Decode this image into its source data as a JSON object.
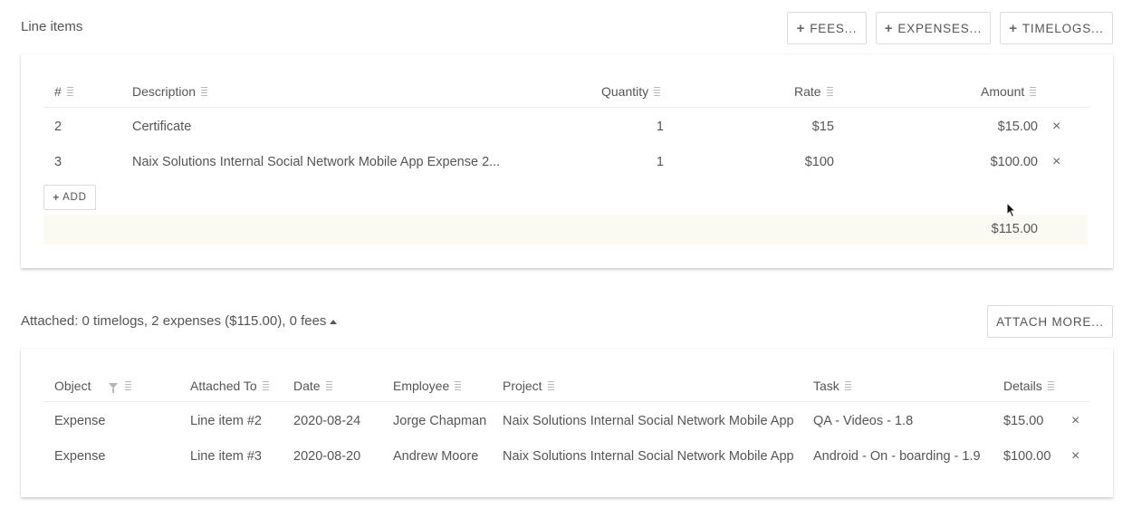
{
  "line_items": {
    "title": "Line items",
    "buttons": {
      "fees": "FEES...",
      "expenses": "EXPENSES...",
      "timelogs": "TIMELOGS..."
    },
    "columns": {
      "num": "#",
      "description": "Description",
      "quantity": "Quantity",
      "rate": "Rate",
      "amount": "Amount"
    },
    "rows": [
      {
        "num": "2",
        "description": "Certificate",
        "quantity": "1",
        "rate": "$15",
        "amount": "$15.00"
      },
      {
        "num": "3",
        "description": "Naix Solutions Internal Social Network Mobile App Expense 2...",
        "quantity": "1",
        "rate": "$100",
        "amount": "$100.00"
      }
    ],
    "add_label": "ADD",
    "total": "$115.00"
  },
  "attached": {
    "summary": "Attached: 0 timelogs, 2 expenses ($115.00), 0 fees",
    "attach_more": "ATTACH MORE...",
    "columns": {
      "object": "Object",
      "attached_to": "Attached To",
      "date": "Date",
      "employee": "Employee",
      "project": "Project",
      "task": "Task",
      "details": "Details"
    },
    "rows": [
      {
        "object": "Expense",
        "attached_to": "Line item #2",
        "date": "2020-08-24",
        "employee": "Jorge Chapman",
        "project": "Naix Solutions Internal Social Network Mobile App",
        "task": "QA - Videos - 1.8",
        "details": "$15.00"
      },
      {
        "object": "Expense",
        "attached_to": "Line item #3",
        "date": "2020-08-20",
        "employee": "Andrew Moore",
        "project": "Naix Solutions Internal Social Network Mobile App",
        "task": "Android - On - boarding - 1.9",
        "details": "$100.00"
      }
    ]
  },
  "icons": {
    "remove": "×"
  }
}
